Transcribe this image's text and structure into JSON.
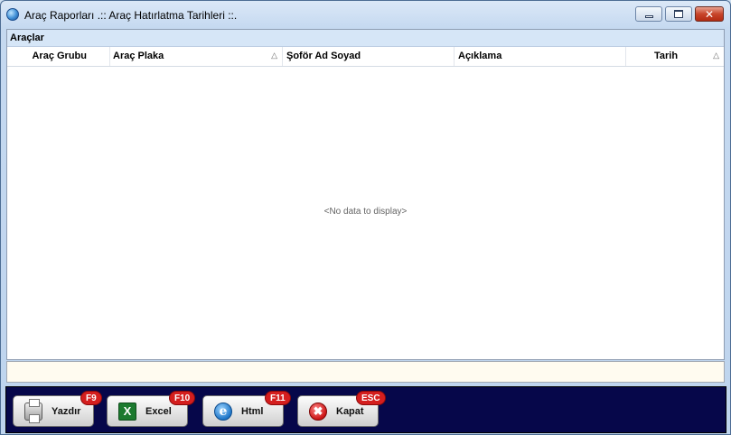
{
  "window": {
    "title": "Araç Raporları  .:: Araç Hatırlatma Tarihleri ::.",
    "controls": {
      "minimize_icon": "minimize-icon",
      "maximize_icon": "maximize-icon",
      "close_icon": "close-icon",
      "close_glyph": "✕"
    }
  },
  "panel": {
    "caption": "Araçlar",
    "columns": [
      {
        "label": "Araç Grubu",
        "sortable": false
      },
      {
        "label": "Araç Plaka",
        "sortable": true,
        "sort_glyph": "△"
      },
      {
        "label": "Şoför Ad Soyad",
        "sortable": false
      },
      {
        "label": "Açıklama",
        "sortable": false
      },
      {
        "label": "Tarih",
        "sortable": true,
        "sort_glyph": "△"
      }
    ],
    "empty_text": "<No data to display>"
  },
  "buttons": {
    "print": {
      "label": "Yazdır",
      "shortcut": "F9",
      "icon": "printer-icon"
    },
    "excel": {
      "label": "Excel",
      "shortcut": "F10",
      "icon": "excel-icon",
      "glyph": "X"
    },
    "html": {
      "label": "Html",
      "shortcut": "F11",
      "icon": "internet-explorer-icon",
      "glyph": "e"
    },
    "close": {
      "label": "Kapat",
      "shortcut": "ESC",
      "icon": "close-icon",
      "glyph": "✖"
    }
  },
  "colors": {
    "button_strip": "#06074a",
    "badge": "#d41e1e",
    "panel_caption": "#d6e6f7",
    "footer": "#fffbf0"
  }
}
